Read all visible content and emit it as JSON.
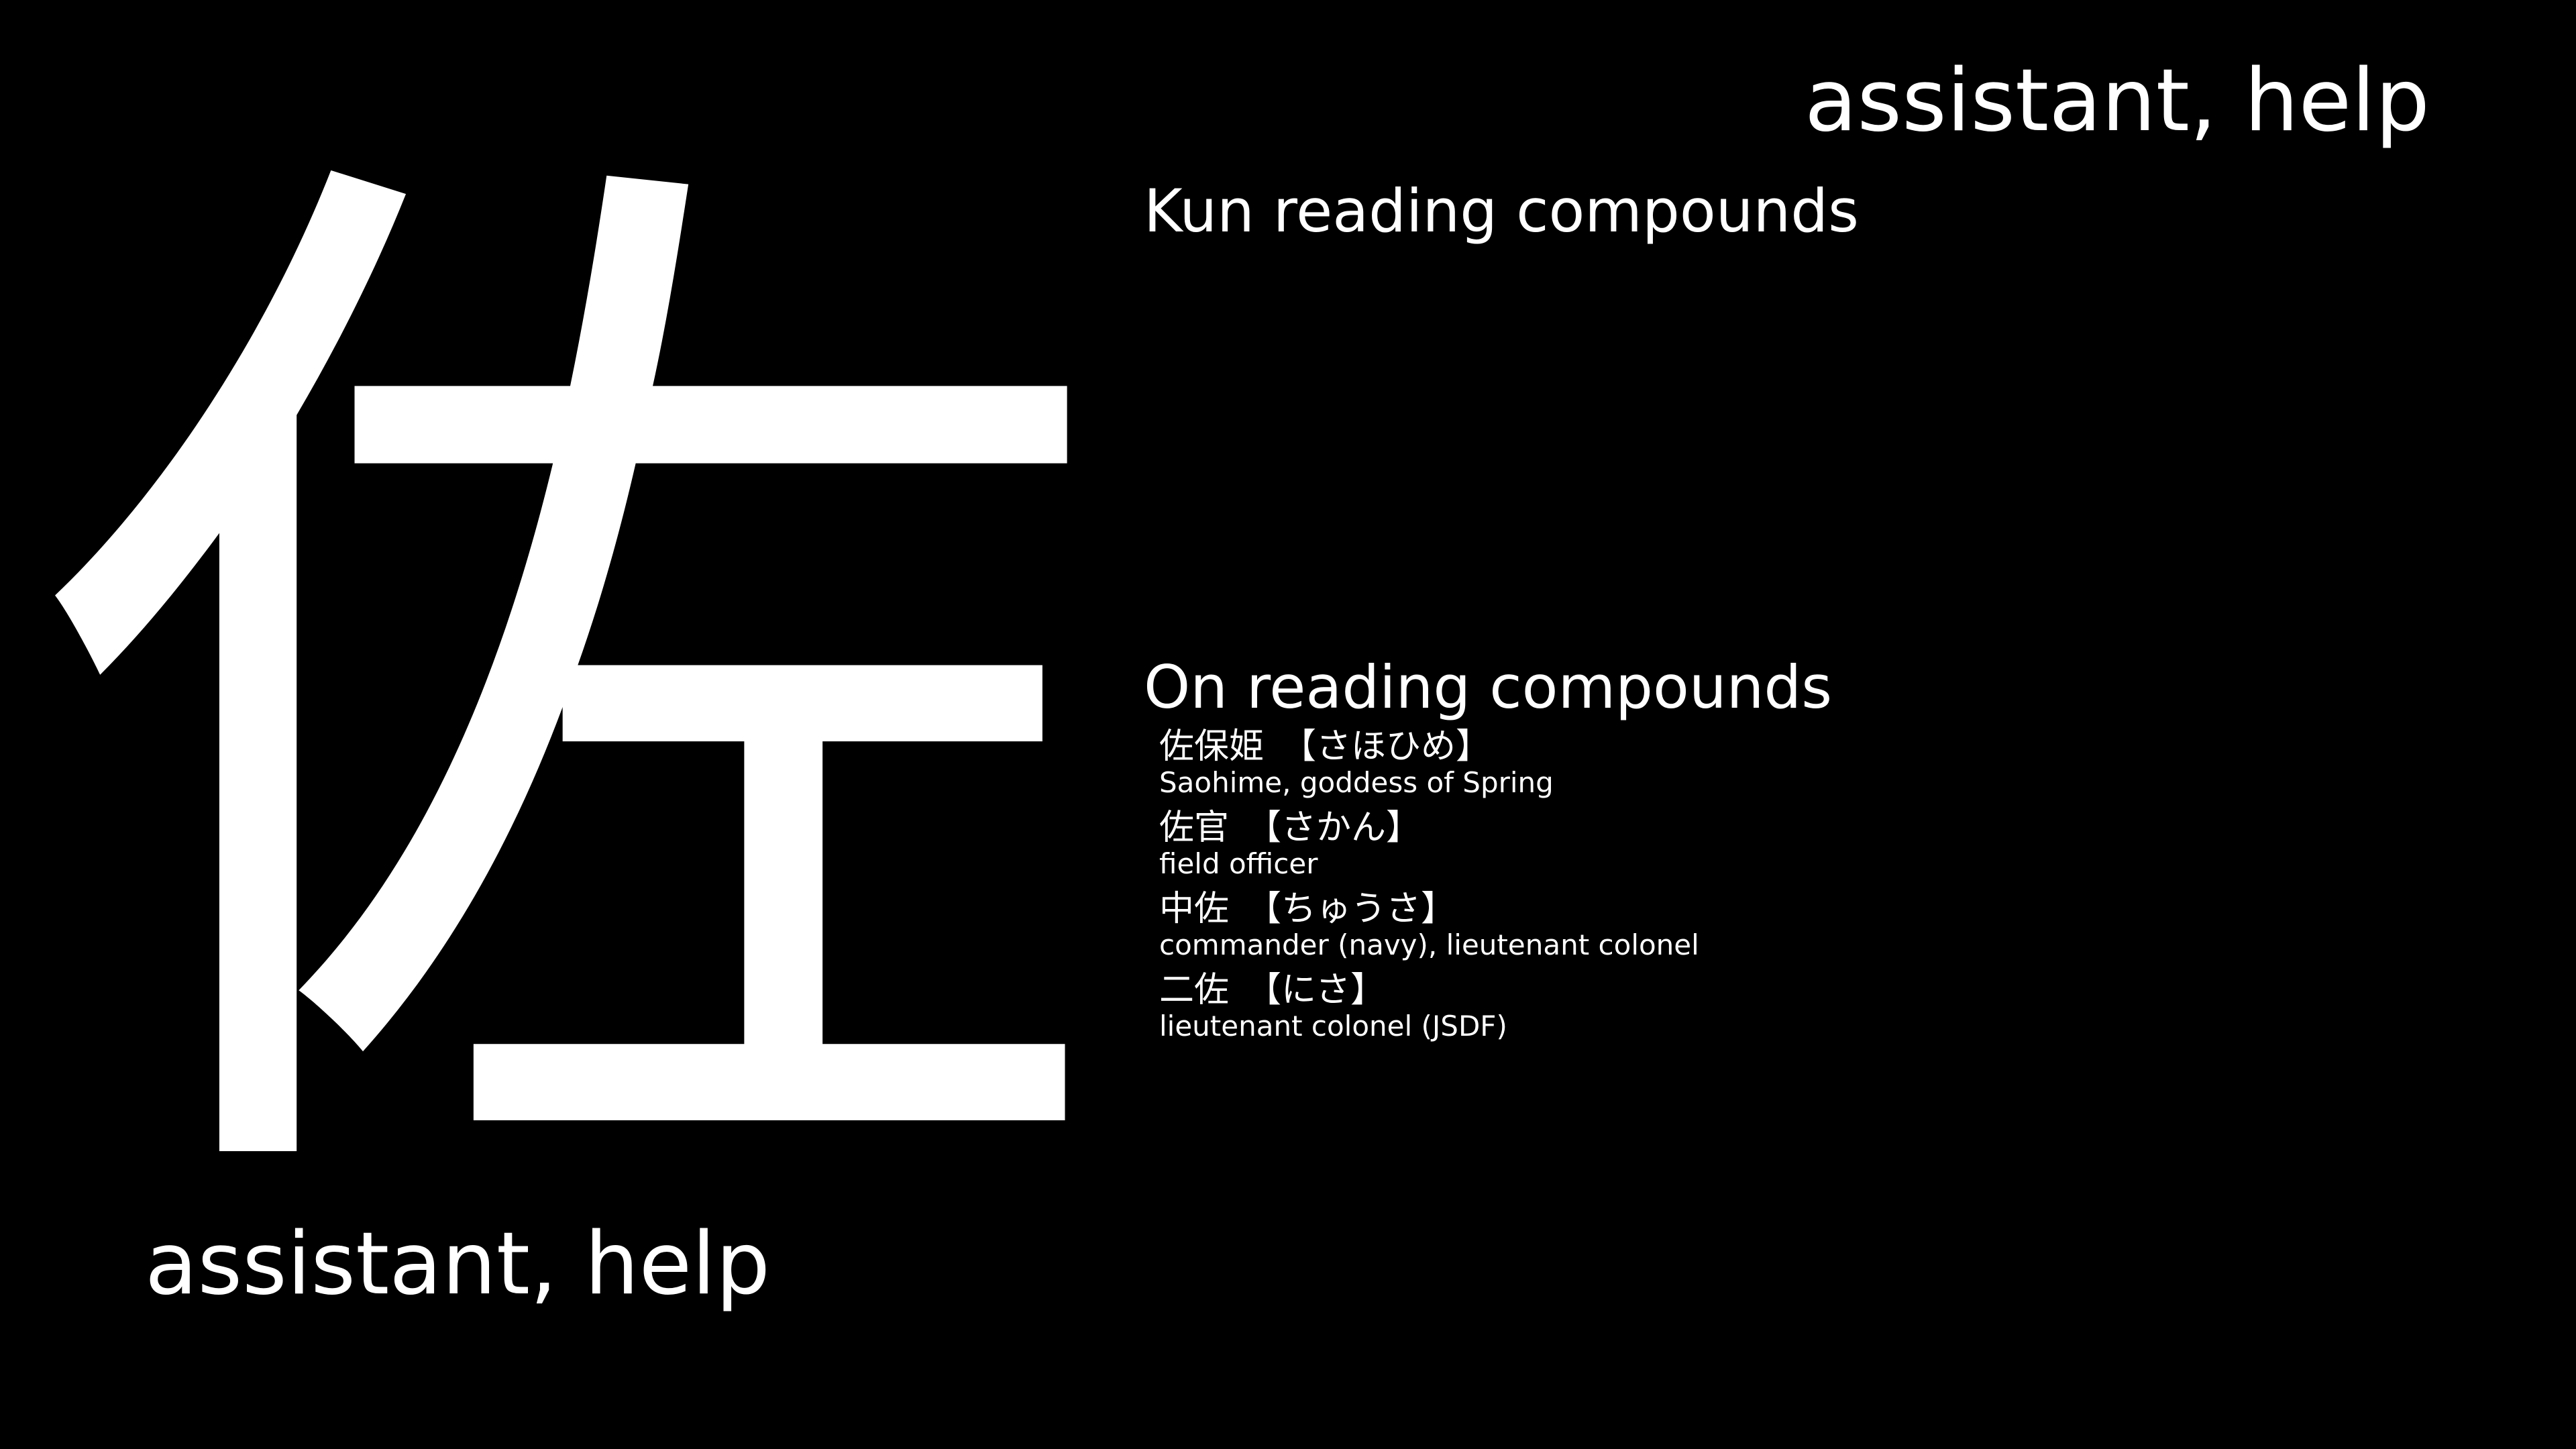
{
  "kanji": "佐",
  "meaning": "assistant, help",
  "kun_heading": "Kun reading compounds",
  "on_heading": "On reading compounds",
  "on_compounds": [
    {
      "word": "佐保姫",
      "reading": "【さほひめ】",
      "gloss": "Saohime, goddess of Spring"
    },
    {
      "word": "佐官",
      "reading": "【さかん】",
      "gloss": "field officer"
    },
    {
      "word": "中佐",
      "reading": "【ちゅうさ】",
      "gloss": "commander (navy), lieutenant colonel"
    },
    {
      "word": "二佐",
      "reading": "【にさ】",
      "gloss": "lieutenant colonel (JSDF)"
    }
  ],
  "colors": {
    "background": "#000000",
    "text": "#ffffff"
  }
}
